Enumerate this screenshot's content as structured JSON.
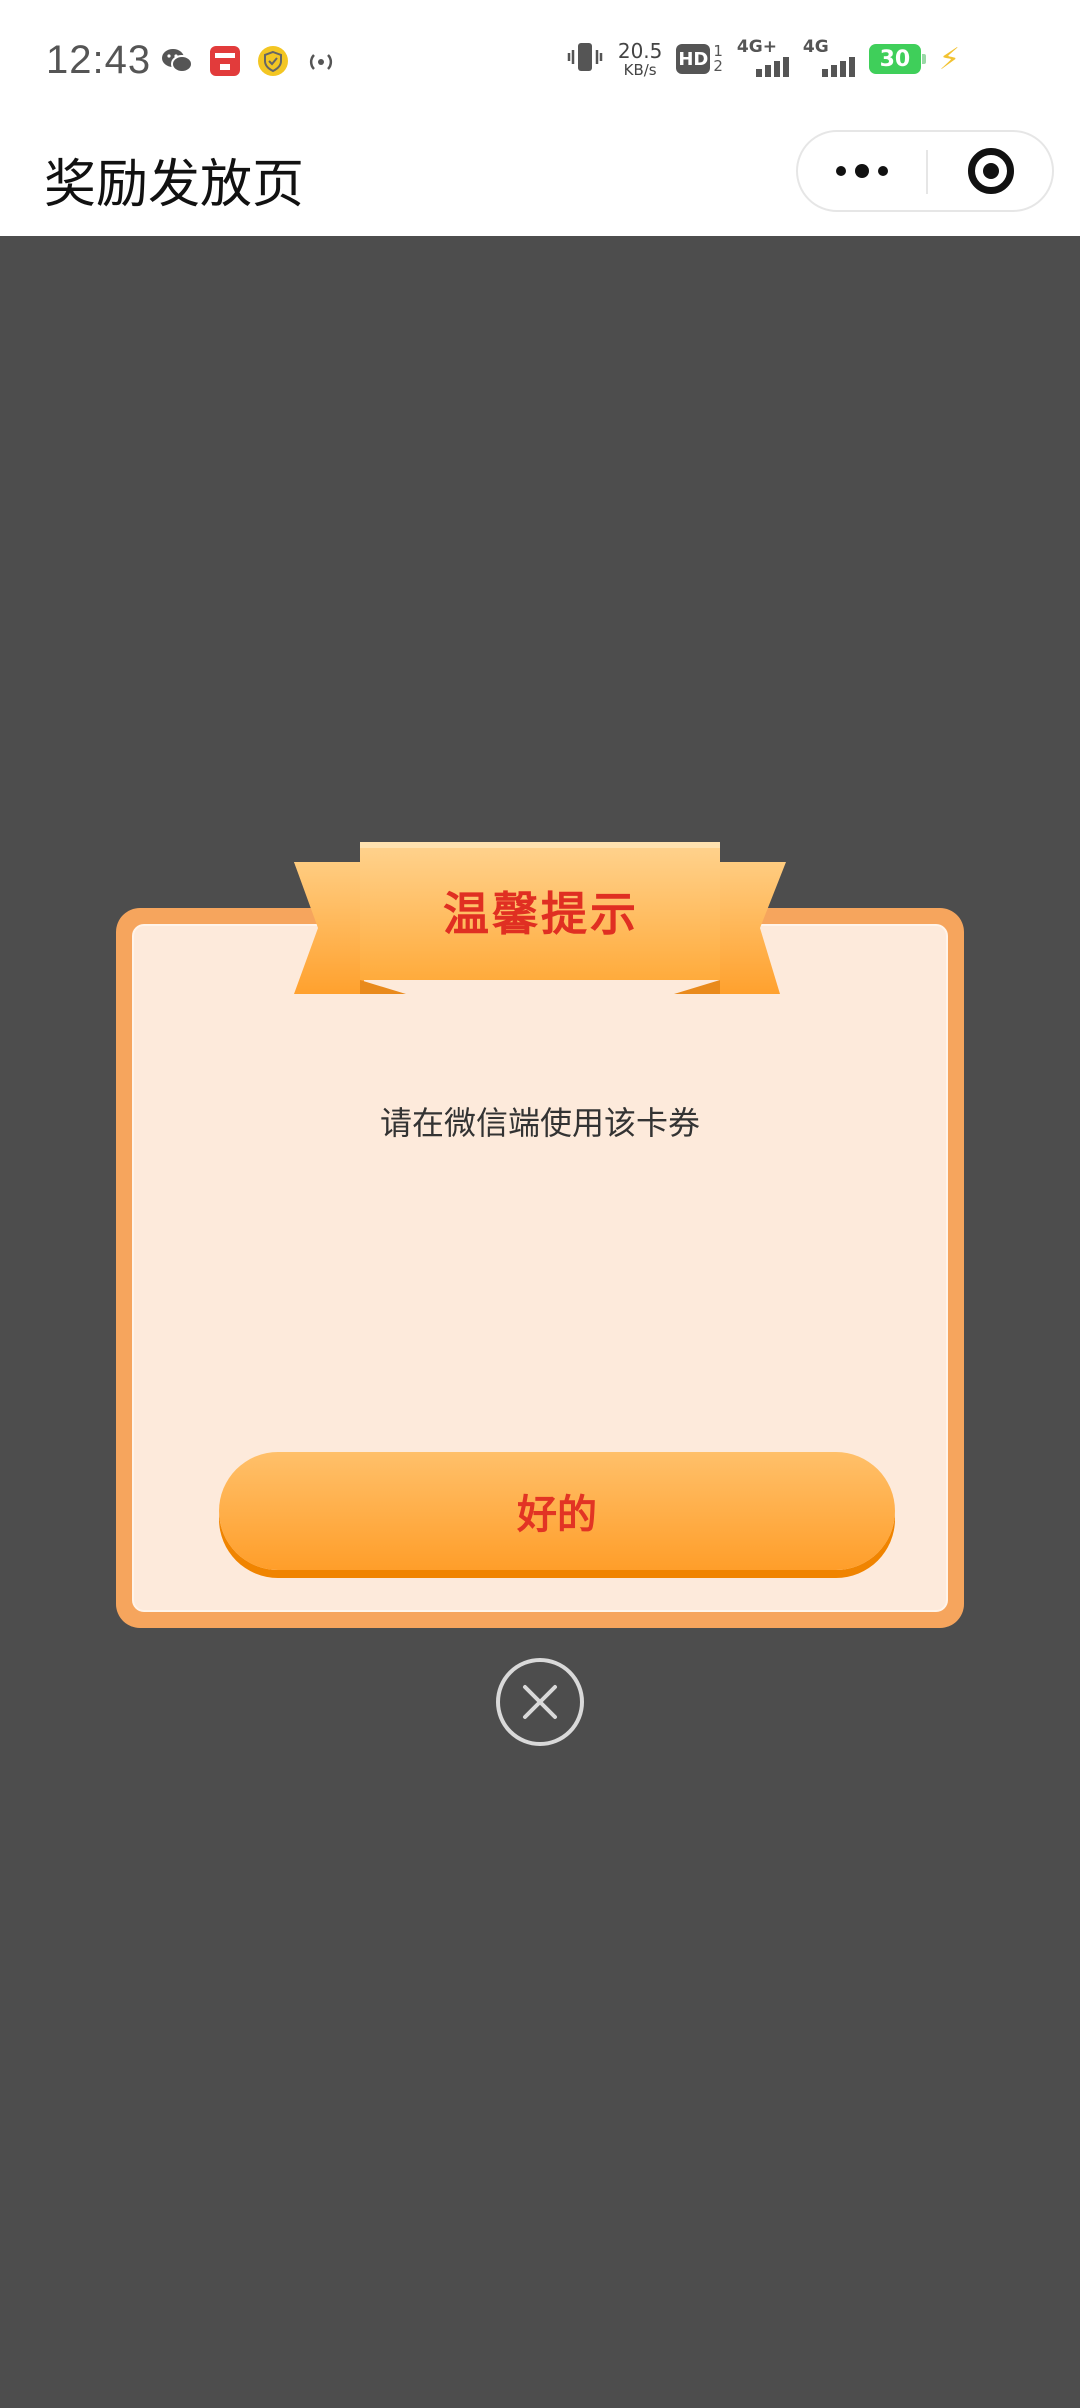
{
  "status_bar": {
    "time": "12:43",
    "speed_value": "20.5",
    "speed_unit": "KB/s",
    "hd_label": "HD",
    "hd_sub": "1\n2",
    "net1_label": "4G+",
    "net2_label": "4G",
    "battery_level": "30",
    "left_icons": [
      "wechat-icon",
      "app-red-icon",
      "shield-icon",
      "hotspot-icon"
    ]
  },
  "header": {
    "title": "奖励发放页"
  },
  "dialog": {
    "ribbon_title": "温馨提示",
    "message": "请在微信端使用该卡券",
    "ok_label": "好的"
  },
  "colors": {
    "overlay": "#4d4d4d",
    "dialog_border": "#f6a55d",
    "dialog_bg": "#fdeadb",
    "button_top": "#ffc06a",
    "button_bottom": "#ff9e2a",
    "accent_text": "#e02f22"
  }
}
